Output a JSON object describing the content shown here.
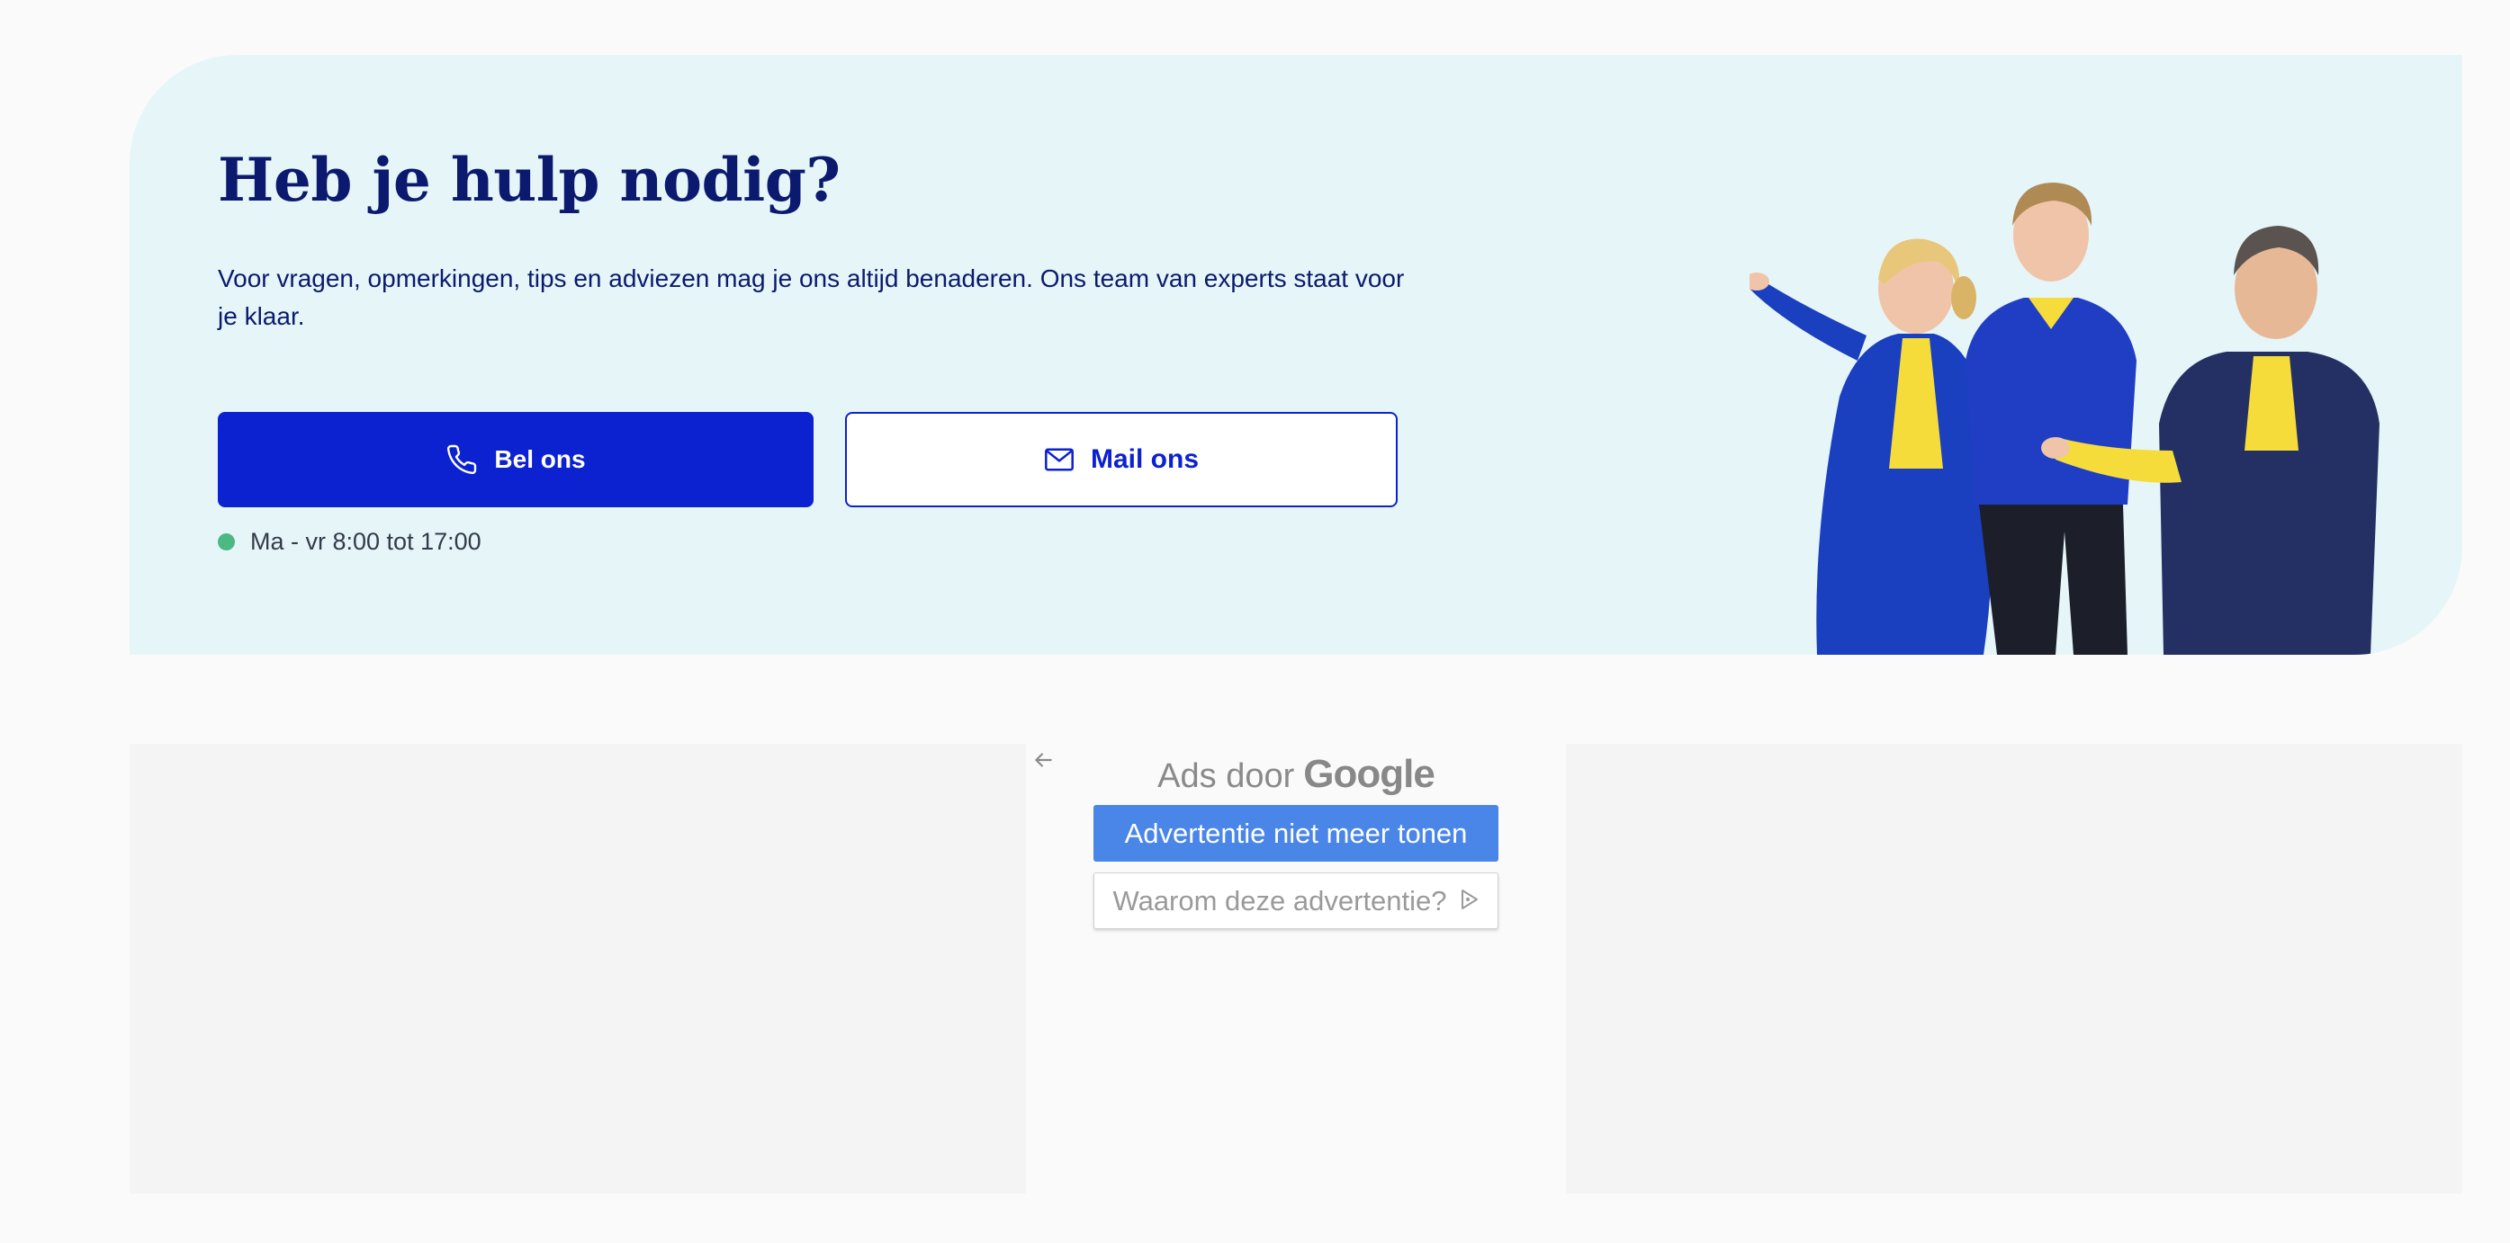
{
  "help_section": {
    "title": "Heb je hulp nodig?",
    "description": "Voor vragen, opmerkingen, tips en adviezen mag je ons altijd benaderen. Ons team van experts staat voor je klaar.",
    "call_button": {
      "label": "Bel ons",
      "icon": "phone-icon"
    },
    "mail_button": {
      "label": "Mail ons",
      "icon": "mail-icon"
    },
    "hours": {
      "text": "Ma - vr 8:00 tot 17:00",
      "status_color": "#4cb883"
    },
    "colors": {
      "background": "#e6f6f8",
      "heading": "#0b1a6e",
      "primary": "#0c21d0"
    }
  },
  "ad_notice": {
    "back_icon": "arrow-left-icon",
    "prefix": "Ads door",
    "brand": "Google",
    "stop_button_label": "Advertentie niet meer tonen",
    "why_button_label": "Waarom deze advertentie?",
    "why_icon": "adchoices-icon",
    "colors": {
      "stop_button": "#4a86e8"
    }
  }
}
